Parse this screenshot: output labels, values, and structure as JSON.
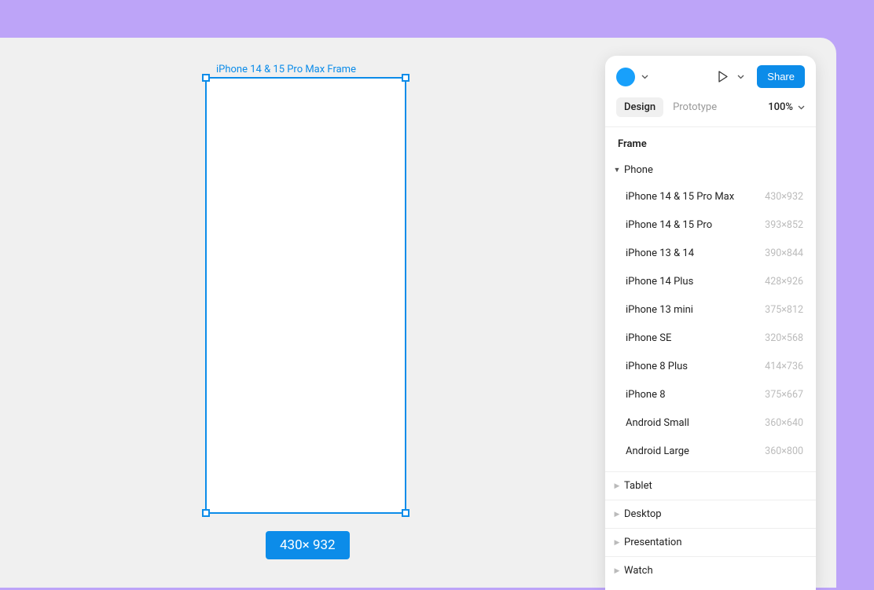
{
  "canvas": {
    "frame_label": "iPhone 14 & 15 Pro Max Frame",
    "dimensions_badge": "430× 932"
  },
  "header": {
    "share_label": "Share",
    "tabs": {
      "design": "Design",
      "prototype": "Prototype"
    },
    "zoom": "100%"
  },
  "frame_panel": {
    "title": "Frame",
    "expanded_category": "Phone",
    "devices": [
      {
        "name": "iPhone 14 & 15 Pro Max",
        "dim": "430×932"
      },
      {
        "name": "iPhone 14 & 15 Pro",
        "dim": "393×852"
      },
      {
        "name": "iPhone 13 & 14",
        "dim": "390×844"
      },
      {
        "name": "iPhone 14 Plus",
        "dim": "428×926"
      },
      {
        "name": "iPhone 13 mini",
        "dim": "375×812"
      },
      {
        "name": "iPhone SE",
        "dim": "320×568"
      },
      {
        "name": "iPhone 8 Plus",
        "dim": "414×736"
      },
      {
        "name": "iPhone 8",
        "dim": "375×667"
      },
      {
        "name": "Android Small",
        "dim": "360×640"
      },
      {
        "name": "Android Large",
        "dim": "360×800"
      }
    ],
    "collapsed_categories": [
      "Tablet",
      "Desktop",
      "Presentation",
      "Watch"
    ]
  }
}
